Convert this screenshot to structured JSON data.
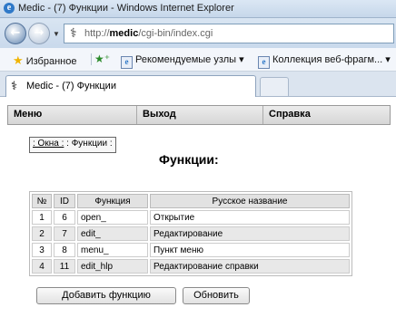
{
  "window": {
    "title": "Medic - (7) Функции - Windows Internet Explorer"
  },
  "address_bar": {
    "url_prefix": "http://",
    "url_host": "medic",
    "url_path": "/cgi-bin/index.cgi"
  },
  "favorites_bar": {
    "favorites_label": "Избранное",
    "suggested_label": "Рекомендуемые узлы ▾",
    "webslice_label": "Коллекция веб-фрагм... ▾"
  },
  "tab": {
    "label": "Medic - (7) Функции"
  },
  "menu": {
    "items": [
      "Меню",
      "Выход",
      "Справка"
    ]
  },
  "breadcrumb": {
    "link": ": Окна :",
    "current": ": Функции :"
  },
  "page_title": "Функции:",
  "table": {
    "headers": [
      "№",
      "ID",
      "Функция",
      "Русское название"
    ],
    "rows": [
      [
        "1",
        "6",
        "open_",
        "Открытие"
      ],
      [
        "2",
        "7",
        "edit_",
        "Редактирование"
      ],
      [
        "3",
        "8",
        "menu_",
        "Пункт меню"
      ],
      [
        "4",
        "11",
        "edit_hlp",
        "Редактирование справки"
      ]
    ]
  },
  "buttons": {
    "add_function": "Добавить функцию",
    "refresh": "Обновить"
  },
  "icons": {
    "browser": "ie-icon",
    "back": "back-arrow-icon",
    "forward": "forward-arrow-icon",
    "site": "caduceus-icon",
    "favorites": "star-icon"
  }
}
